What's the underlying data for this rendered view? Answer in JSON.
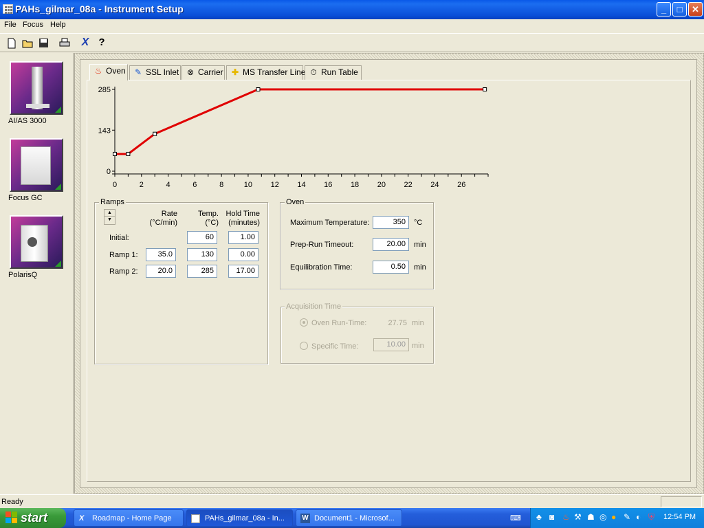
{
  "window": {
    "title": "PAHs_gilmar_08a - Instrument Setup",
    "minimize": "_",
    "maximize": "□",
    "close": "✕"
  },
  "menu": [
    "File",
    "Focus",
    "Help"
  ],
  "toolbar": [
    {
      "name": "new-icon"
    },
    {
      "name": "open-icon"
    },
    {
      "name": "save-icon"
    },
    {
      "name": "print-icon"
    },
    {
      "name": "cut-icon"
    },
    {
      "name": "help-icon"
    }
  ],
  "instruments": [
    {
      "label": "AI/AS 3000",
      "name": "instrument-aias3000"
    },
    {
      "label": "Focus GC",
      "name": "instrument-focus-gc"
    },
    {
      "label": "PolarisQ",
      "name": "instrument-polarisq"
    }
  ],
  "tabs": [
    {
      "label": "Oven",
      "icon": "flame-icon",
      "active": true
    },
    {
      "label": "SSL Inlet",
      "icon": "pen-icon"
    },
    {
      "label": "Carrier",
      "icon": "carrier-icon"
    },
    {
      "label": "MS Transfer Line",
      "icon": "plus-icon"
    },
    {
      "label": "Run Table",
      "icon": "stopwatch-icon"
    }
  ],
  "chart_data": {
    "type": "line",
    "x_ticks": [
      "0",
      "2",
      "4",
      "6",
      "8",
      "10",
      "12",
      "14",
      "16",
      "18",
      "20",
      "22",
      "24",
      "26"
    ],
    "y_ticks": [
      "0",
      "143",
      "285"
    ],
    "xlim": [
      0,
      28
    ],
    "ylim": [
      0,
      285
    ],
    "series": [
      {
        "color": "#e00000",
        "points": [
          [
            0,
            60
          ],
          [
            1,
            60
          ],
          [
            3,
            130
          ],
          [
            10.75,
            285
          ],
          [
            27.75,
            285
          ]
        ]
      }
    ]
  },
  "ramps": {
    "title": "Ramps",
    "headers": {
      "rate": "Rate (°C/min)",
      "rate1": "Rate",
      "rate2": "(°C/min)",
      "temp1": "Temp.",
      "temp2": "(°C)",
      "hold1": "Hold Time",
      "hold2": "(minutes)"
    },
    "rows": [
      {
        "label": "Initial:",
        "rate": null,
        "temp": "60",
        "hold": "1.00"
      },
      {
        "label": "Ramp 1:",
        "rate": "35.0",
        "temp": "130",
        "hold": "0.00"
      },
      {
        "label": "Ramp 2:",
        "rate": "20.0",
        "temp": "285",
        "hold": "17.00"
      }
    ]
  },
  "oven": {
    "title": "Oven",
    "max_temp_label": "Maximum Temperature:",
    "max_temp": "350",
    "max_temp_unit": "°C",
    "prep_label": "Prep-Run Timeout:",
    "prep": "20.00",
    "prep_unit": "min",
    "equil_label": "Equilibration Time:",
    "equil": "0.50",
    "equil_unit": "min"
  },
  "acquisition": {
    "title": "Acquisition Time",
    "oven_runtime_label": "Oven Run-Time:",
    "oven_runtime": "27.75",
    "oven_runtime_unit": "min",
    "specific_label": "Specific Time:",
    "specific": "10.00",
    "specific_unit": "min"
  },
  "status": {
    "text": "Ready"
  },
  "taskbar": {
    "start": "start",
    "tasks": [
      {
        "label": "Roadmap - Home Page",
        "icon": "xcalibur-icon"
      },
      {
        "label": "PAHs_gilmar_08a - In...",
        "icon": "app-icon",
        "active": true
      },
      {
        "label": "Document1 - Microsof...",
        "icon": "word-icon"
      }
    ],
    "clock": "12:54 PM"
  }
}
